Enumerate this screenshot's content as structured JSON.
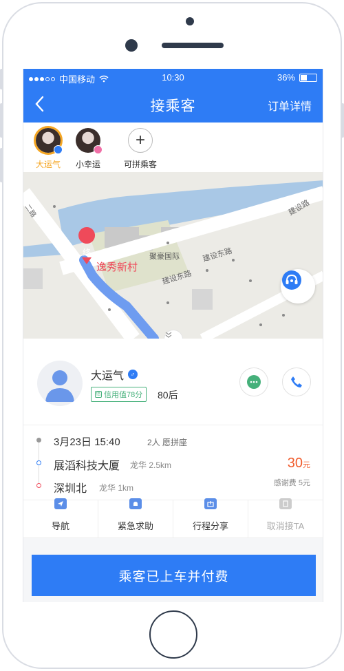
{
  "status_bar": {
    "carrier": "中国移动",
    "time": "10:30",
    "battery": "36%"
  },
  "nav": {
    "title": "接乘客",
    "right_label": "订单详情",
    "back_icon": "chevron-left-icon"
  },
  "passengers": [
    {
      "label": "大运气",
      "active": true
    },
    {
      "label": "小幸运",
      "active": false
    }
  ],
  "add_passenger_label": "可拼乘客",
  "map": {
    "destination_marker": "终",
    "destination_label": "逸秀新村",
    "area_label": "聚豪国际",
    "road_1": "建设东路",
    "road_2": "建设东路",
    "road_3": "建设路",
    "road_left": "二路"
  },
  "driver": {
    "name": "大运气",
    "credit": "信用值78分",
    "age": "80后"
  },
  "trip": {
    "time": "3月23日 15:40",
    "seats": "2人 愿拼座",
    "from": "展滔科技大厦",
    "from_sub": "龙华 2.5km",
    "to": "深圳北",
    "to_sub": "龙华 1km",
    "price": "30",
    "price_unit": "元",
    "tip": "感谢费 5元"
  },
  "actions": [
    {
      "label": "导航",
      "icon": "navigation-icon",
      "disabled": false
    },
    {
      "label": "紧急求助",
      "icon": "emergency-icon",
      "disabled": false
    },
    {
      "label": "行程分享",
      "icon": "share-icon",
      "disabled": false
    },
    {
      "label": "取消接TA",
      "icon": "cancel-icon",
      "disabled": true
    }
  ],
  "main_button": "乘客已上车并付费",
  "colors": {
    "primary": "#2e7cf5",
    "accent": "#f5a623",
    "price": "#f05a2a",
    "credit": "#45b07a",
    "marker": "#ef4a5a"
  }
}
